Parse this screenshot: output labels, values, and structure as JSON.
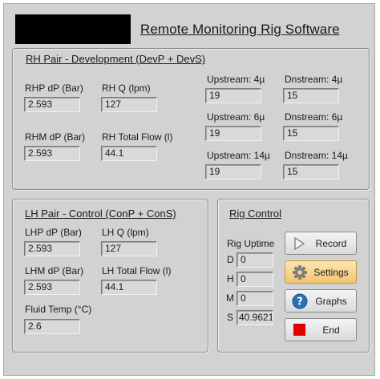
{
  "app": {
    "title": "Remote Monitoring Rig Software"
  },
  "rh_panel": {
    "title": "RH Pair - Development (DevP + DevS)",
    "rhp_dp": {
      "label": "RHP dP (Bar)",
      "value": "2.593"
    },
    "rh_q": {
      "label": "RH Q (lpm)",
      "value": "127"
    },
    "rhm_dp": {
      "label": "RHM dP (Bar)",
      "value": "2.593"
    },
    "rh_total_flow": {
      "label": "RH Total Flow (l)",
      "value": "44.1"
    },
    "upstream_4": {
      "label": "Upstream: 4µ",
      "value": "19"
    },
    "dnstream_4": {
      "label": "Dnstream: 4µ",
      "value": "15"
    },
    "upstream_6": {
      "label": "Upstream: 6µ",
      "value": "19"
    },
    "dnstream_6": {
      "label": "Dnstream: 6µ",
      "value": "15"
    },
    "upstream_14": {
      "label": "Upstream: 14µ",
      "value": "19"
    },
    "dnstream_14": {
      "label": "Dnstream: 14µ",
      "value": "15"
    }
  },
  "lh_panel": {
    "title": "LH Pair - Control (ConP + ConS)",
    "lhp_dp": {
      "label": "LHP dP (Bar)",
      "value": "2.593"
    },
    "lh_q": {
      "label": "LH Q (lpm)",
      "value": "127"
    },
    "lhm_dp": {
      "label": "LHM dP (Bar)",
      "value": "2.593"
    },
    "lh_total_flow": {
      "label": "LH Total Flow (l)",
      "value": "44.1"
    },
    "fluid_temp": {
      "label": "Fluid Temp (°C)",
      "value": "2.6"
    }
  },
  "rig_control": {
    "title": "Rig Control",
    "uptime_label": "Rig Uptime",
    "days": {
      "label": "D",
      "value": "0"
    },
    "hours": {
      "label": "H",
      "value": "0"
    },
    "minutes": {
      "label": "M",
      "value": "0"
    },
    "seconds": {
      "label": "S",
      "value": "40.9621"
    },
    "buttons": {
      "record": {
        "label": "Record",
        "icon": "play-icon"
      },
      "settings": {
        "label": "Settings",
        "icon": "gear-icon",
        "active": true
      },
      "graphs": {
        "label": "Graphs",
        "icon": "help-icon"
      },
      "end": {
        "label": "End",
        "icon": "stop-icon"
      }
    }
  },
  "colors": {
    "background": "#d2d2d2",
    "settings_active": "#f3c56e",
    "help_icon": "#2f6fb5",
    "stop_icon": "#e00000"
  }
}
